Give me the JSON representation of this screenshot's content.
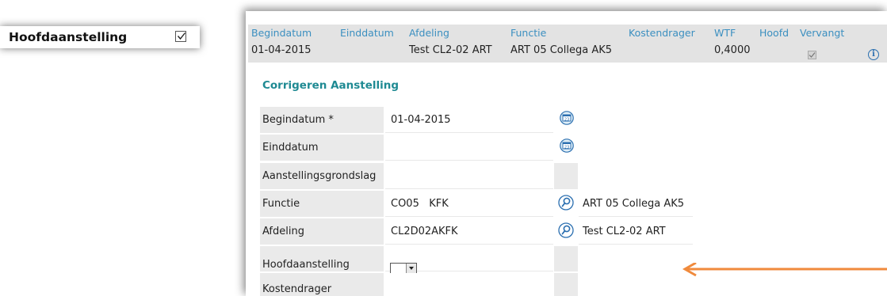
{
  "callout": {
    "label": "Hoofdaanstelling",
    "checked": true
  },
  "grid": {
    "headers": [
      "Begindatum",
      "Einddatum",
      "Afdeling",
      "Functie",
      "Kostendrager",
      "WTF",
      "Hoofd",
      "Vervangt"
    ],
    "row": {
      "begindatum": "01-04-2015",
      "einddatum": "",
      "afdeling": "Test CL2-02 ART",
      "functie": "ART 05 Collega AK5",
      "kostendrager": "",
      "wtf": "0,4000",
      "hoofd_checked": true,
      "vervangt": ""
    },
    "info_icon": "info-icon"
  },
  "form": {
    "title": "Corrigeren Aanstelling",
    "fields": [
      {
        "label": "Begindatum *",
        "value": "01-04-2015",
        "button": "calendar-icon",
        "description": ""
      },
      {
        "label": "Einddatum",
        "value": "",
        "button": "calendar-icon",
        "description": ""
      },
      {
        "label": "Aanstellingsgrondslag",
        "value": "",
        "button": "",
        "description": ""
      },
      {
        "label": "Functie",
        "value": "CO05   KFK",
        "button": "lookup-icon",
        "description": "ART 05 Collega AK5"
      },
      {
        "label": "Afdeling",
        "value": "CL2D02AKFK",
        "button": "lookup-icon",
        "description": "Test CL2-02 ART"
      },
      {
        "label": "Hoofdaanstelling",
        "value": "",
        "button": "",
        "description": ""
      },
      {
        "label": "Kostendrager",
        "value": "",
        "button": "",
        "description": ""
      }
    ]
  },
  "annotation": {
    "arrow_color": "#f08a3c"
  },
  "colors": {
    "header_text": "#3b8fc0",
    "title": "#1f8a93",
    "accent": "#2b6fb0"
  }
}
